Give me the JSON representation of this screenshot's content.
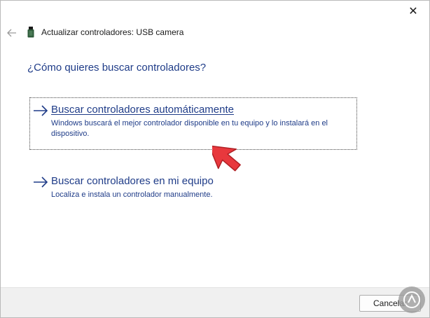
{
  "window": {
    "title": "Actualizar controladores: USB camera",
    "close_glyph": "✕"
  },
  "main": {
    "heading": "¿Cómo quieres buscar controladores?",
    "options": [
      {
        "title": "Buscar controladores automáticamente",
        "description": "Windows buscará el mejor controlador disponible en tu equipo y lo instalará en el dispositivo.",
        "icon": "arrow-right-icon",
        "focused": true
      },
      {
        "title": "Buscar controladores en mi equipo",
        "description": "Localiza e instala un controlador manualmente.",
        "icon": "arrow-right-icon",
        "focused": false
      }
    ]
  },
  "footer": {
    "cancel_label": "Cancelar"
  },
  "colors": {
    "link_text": "#1f3c88",
    "pointer": "#e8383d",
    "footer_bg": "#f0f0f0"
  },
  "icons": {
    "back": "back-arrow-icon",
    "device": "usb-device-icon",
    "pointer": "red-pointer-arrow-icon",
    "watermark": "logo-watermark-icon"
  }
}
